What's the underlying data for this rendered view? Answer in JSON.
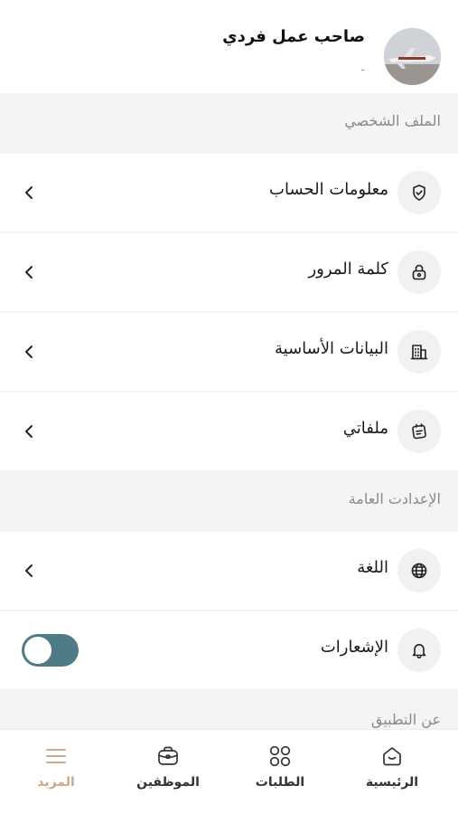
{
  "header": {
    "user_name": "صاحب عمل فردي",
    "user_sub": "-"
  },
  "sections": {
    "profile_title": "الملف الشخصي",
    "settings_title": "الإعدادت العامة",
    "about_title": "عن التطبيق"
  },
  "profile_items": [
    {
      "label": "معلومات الحساب",
      "icon": "shield-check-icon"
    },
    {
      "label": "كلمة المرور",
      "icon": "lock-icon"
    },
    {
      "label": "البيانات الأساسية",
      "icon": "building-icon"
    },
    {
      "label": "ملفاتي",
      "icon": "document-icon"
    }
  ],
  "settings_items": [
    {
      "label": "اللغة",
      "icon": "globe-icon"
    },
    {
      "label": "الإشعارات",
      "icon": "bell-icon",
      "toggle_on": true
    }
  ],
  "tabbar": {
    "home": "الرئيسية",
    "requests": "الطلبات",
    "employees": "الموظفين",
    "more": "المزيد"
  },
  "colors": {
    "accent": "#c9a98b",
    "toggle": "#4f7b85",
    "background": "#f4f4f4"
  }
}
